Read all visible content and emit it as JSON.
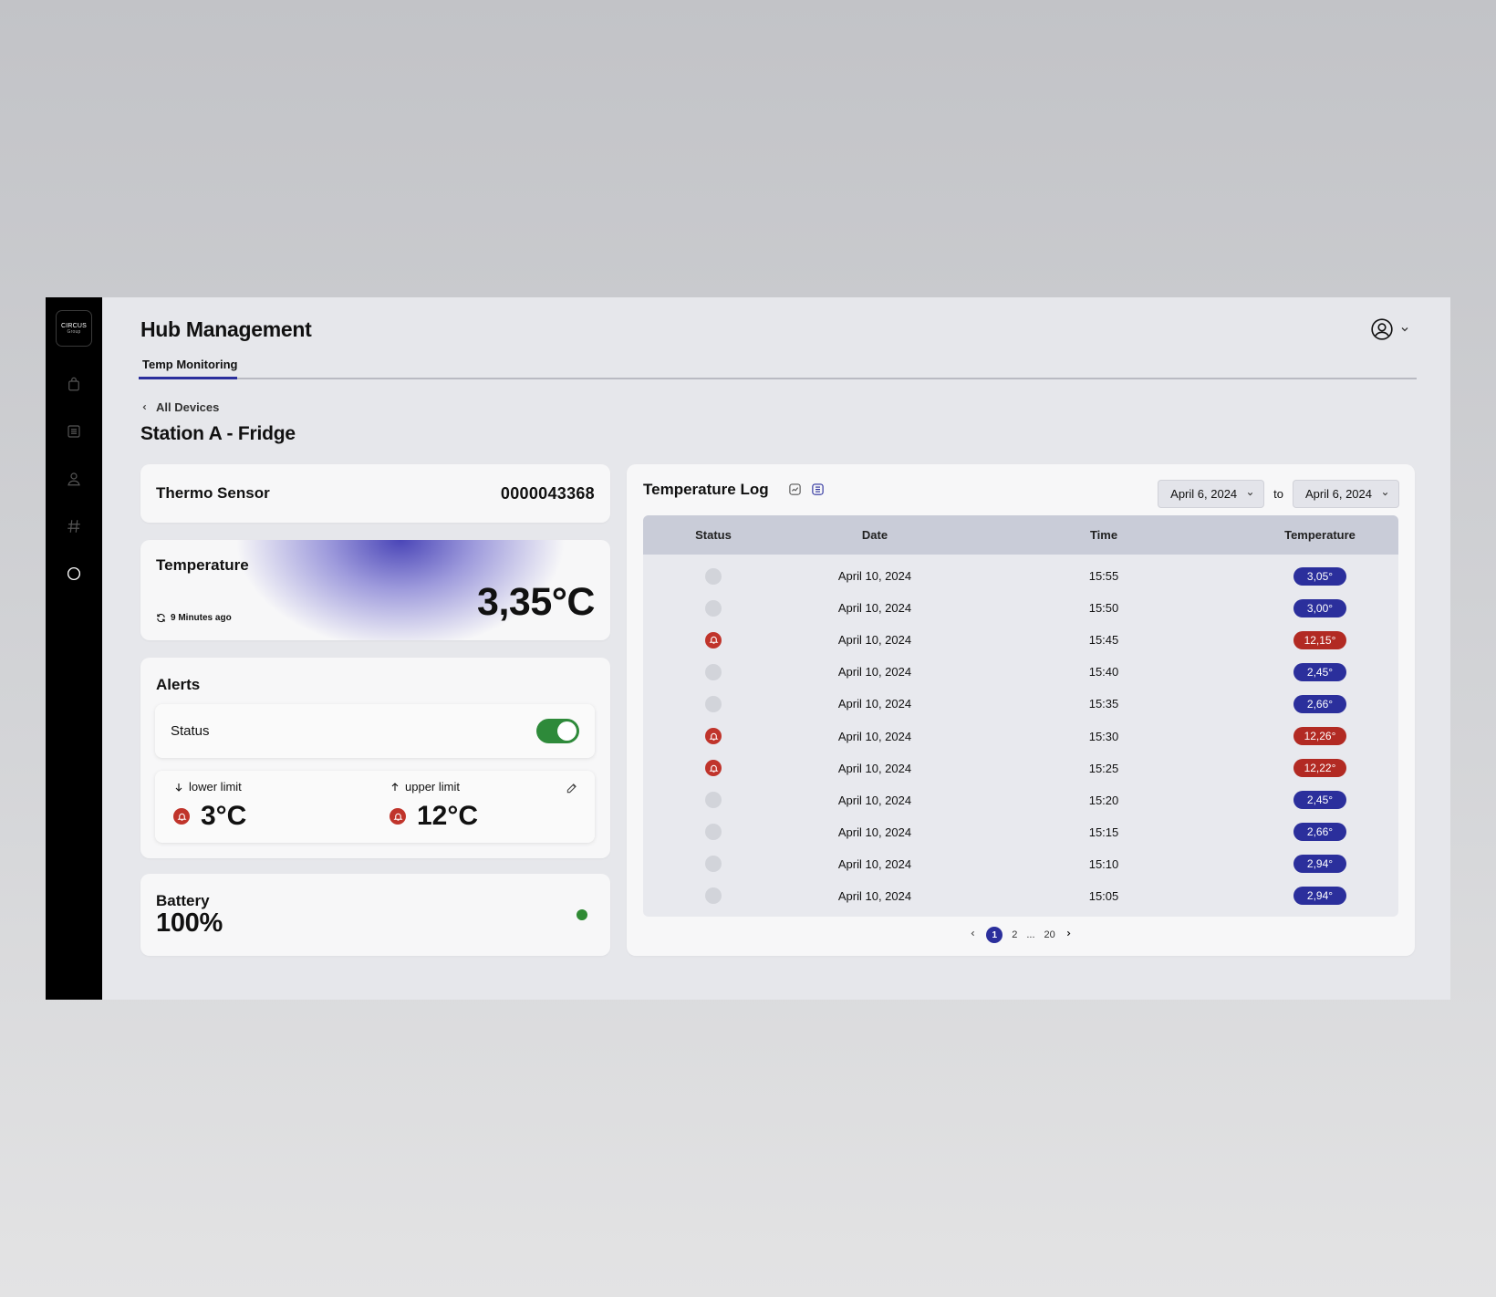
{
  "brand": {
    "logo_line1": "CIRCUS",
    "logo_line2": "Group"
  },
  "header": {
    "title": "Hub Management",
    "tab_active": "Temp Monitoring"
  },
  "breadcrumb": {
    "back_label": "All Devices"
  },
  "device": {
    "title": "Station A - Fridge"
  },
  "sensor": {
    "label": "Thermo Sensor",
    "id": "0000043368"
  },
  "temperature": {
    "label": "Temperature",
    "value": "3,35°C",
    "updated": "9 Minutes ago"
  },
  "alerts": {
    "label": "Alerts",
    "status_label": "Status",
    "status_enabled": true,
    "lower_label": "lower limit",
    "lower_value": "3°C",
    "upper_label": "upper limit",
    "upper_value": "12°C"
  },
  "battery": {
    "label": "Battery",
    "value": "100%"
  },
  "log": {
    "title": "Temperature Log",
    "from_date": "April 6, 2024",
    "to_label": "to",
    "to_date": "April 6, 2024",
    "columns": [
      "Status",
      "Date",
      "Time",
      "Temperature"
    ],
    "rows": [
      {
        "status": "normal",
        "date": "April 10, 2024",
        "time": "15:55",
        "temp": "3,05°"
      },
      {
        "status": "normal",
        "date": "April 10, 2024",
        "time": "15:50",
        "temp": "3,00°"
      },
      {
        "status": "alert",
        "date": "April 10, 2024",
        "time": "15:45",
        "temp": "12,15°"
      },
      {
        "status": "normal",
        "date": "April 10, 2024",
        "time": "15:40",
        "temp": "2,45°"
      },
      {
        "status": "normal",
        "date": "April 10, 2024",
        "time": "15:35",
        "temp": "2,66°"
      },
      {
        "status": "alert",
        "date": "April 10, 2024",
        "time": "15:30",
        "temp": "12,26°"
      },
      {
        "status": "alert",
        "date": "April 10, 2024",
        "time": "15:25",
        "temp": "12,22°"
      },
      {
        "status": "normal",
        "date": "April 10, 2024",
        "time": "15:20",
        "temp": "2,45°"
      },
      {
        "status": "normal",
        "date": "April 10, 2024",
        "time": "15:15",
        "temp": "2,66°"
      },
      {
        "status": "normal",
        "date": "April 10, 2024",
        "time": "15:10",
        "temp": "2,94°"
      },
      {
        "status": "normal",
        "date": "April 10, 2024",
        "time": "15:05",
        "temp": "2,94°"
      }
    ],
    "pagination": {
      "current": "1",
      "next": "2",
      "ellipsis": "...",
      "last": "20"
    }
  },
  "colors": {
    "accent": "#2b2f9c",
    "alert": "#b22a23",
    "toggle_on": "#2e8a3a",
    "battery_ok": "#2f8a34"
  },
  "icons": {
    "sidebar": [
      "bag-icon",
      "list-icon",
      "user-icon",
      "hash-icon",
      "circle-icon"
    ],
    "header": [
      "user-circle-icon",
      "chevron-down-icon"
    ]
  }
}
